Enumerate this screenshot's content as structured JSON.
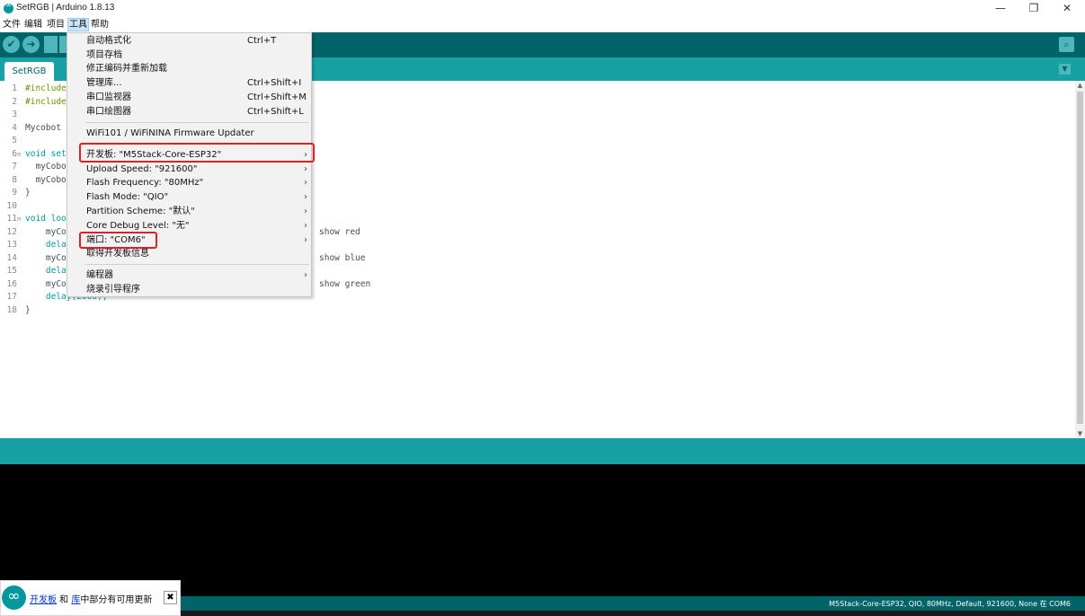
{
  "window": {
    "title": "SetRGB | Arduino 1.8.13",
    "controls": {
      "minimize": "—",
      "maximize": "❐",
      "close": "✕"
    }
  },
  "menubar": [
    "文件",
    "编辑",
    "项目",
    "工具",
    "帮助"
  ],
  "toolbar": {
    "verify_icon": "check-icon",
    "upload_icon": "arrow-right-icon",
    "new_icon": "file-icon",
    "serial_monitor_icon": "magnifier-icon"
  },
  "tabs": [
    {
      "label": "SetRGB"
    }
  ],
  "editor": {
    "line_numbers": [
      "1",
      "2",
      "3",
      "4",
      "5",
      "6",
      "7",
      "8",
      "9",
      "10",
      "11",
      "12",
      "13",
      "14",
      "15",
      "16",
      "17",
      "18"
    ],
    "lines": {
      "l1": "#include",
      "l2": "#include",
      "l4": "Mycobot",
      "l6": "void set",
      "l7": "  myCobo",
      "l8": "  myCobo",
      "l9": "}",
      "l11": "void loo",
      "l12": "    myCo",
      "l13": "    dela",
      "l14": "    myCo",
      "l15": "    dela",
      "l16": "    myCo",
      "l17": "    delay(2000);",
      "l18": "}",
      "c12": "show red",
      "c14": "show blue",
      "c16": "show green"
    }
  },
  "tools_menu": {
    "items": [
      {
        "label": "自动格式化",
        "shortcut": "Ctrl+T"
      },
      {
        "label": "项目存档",
        "shortcut": ""
      },
      {
        "label": "修正编码并重新加载",
        "shortcut": ""
      },
      {
        "label": "管理库...",
        "shortcut": "Ctrl+Shift+I"
      },
      {
        "label": "串口监视器",
        "shortcut": "Ctrl+Shift+M"
      },
      {
        "label": "串口绘图器",
        "shortcut": "Ctrl+Shift+L"
      },
      {
        "label": "WiFi101 / WiFiNINA Firmware Updater",
        "shortcut": ""
      },
      {
        "label": "开发板: \"M5Stack-Core-ESP32\"",
        "shortcut": "",
        "submenu": true
      },
      {
        "label": "Upload Speed: \"921600\"",
        "shortcut": "",
        "submenu": true
      },
      {
        "label": "Flash Frequency: \"80MHz\"",
        "shortcut": "",
        "submenu": true
      },
      {
        "label": "Flash Mode: \"QIO\"",
        "shortcut": "",
        "submenu": true
      },
      {
        "label": "Partition Scheme: \"默认\"",
        "shortcut": "",
        "submenu": true
      },
      {
        "label": "Core Debug Level: \"无\"",
        "shortcut": "",
        "submenu": true
      },
      {
        "label": "端口: \"COM6\"",
        "shortcut": "",
        "submenu": true
      },
      {
        "label": "取得开发板信息",
        "shortcut": ""
      },
      {
        "label": "编程器",
        "shortcut": "",
        "submenu": true
      },
      {
        "label": "烧录引导程序",
        "shortcut": ""
      }
    ]
  },
  "status": {
    "text": "M5Stack-Core-ESP32, QIO, 80MHz, Default, 921600, None 在 COM6"
  },
  "notification": {
    "link1": "开发板",
    "mid": " 和 ",
    "link2": "库",
    "tail": "中部分有可用更新",
    "close_label": "✖"
  },
  "colors": {
    "toolbar": "#006468",
    "tabstrip": "#17a1a5",
    "highlight": "#e02020",
    "console": "#000000"
  }
}
